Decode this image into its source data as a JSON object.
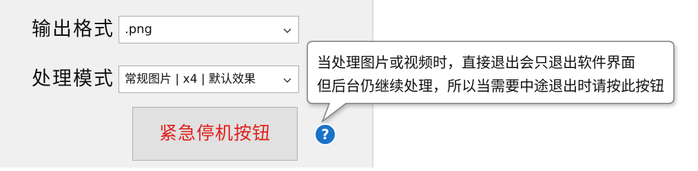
{
  "form": {
    "output_format_label": "输出格式",
    "output_format_value": ".png",
    "process_mode_label": "处理模式",
    "process_mode_value": "常规图片 | x4 | 默认效果"
  },
  "buttons": {
    "emergency_stop_label": "紧急停机按钮"
  },
  "help": {
    "icon_glyph": "?",
    "tooltip_line1": "当处理图片或视频时，直接退出会只退出软件界面",
    "tooltip_line2": "但后台仍继续处理，所以当需要中途退出时请按此按钮"
  },
  "colors": {
    "panel_bg": "#f0f0f0",
    "stop_text": "#e0201a",
    "help_icon": "#1a73c8"
  }
}
